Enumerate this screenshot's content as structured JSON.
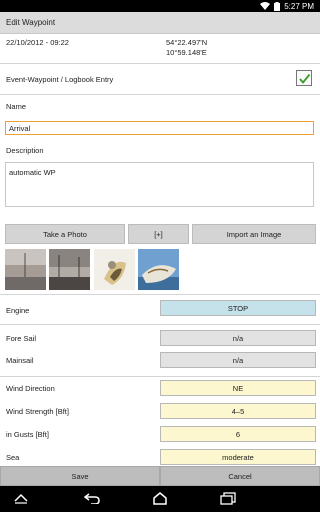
{
  "status_bar": {
    "time": "5:27 PM"
  },
  "header": {
    "title": "Edit Waypoint"
  },
  "waypoint": {
    "datetime": "22/10/2012 - 09:22",
    "latitude": "54°22.497'N",
    "longitude": "10°59.148'E",
    "event_label": "Event-Waypoint / Logbook Entry",
    "event_checked": true
  },
  "form": {
    "name_label": "Name",
    "name_value": "Arrival",
    "description_label": "Description",
    "description_value": "automatic WP"
  },
  "photo_buttons": {
    "take_photo": "Take a Photo",
    "add": "[+]",
    "import": "Import an Image"
  },
  "fields": {
    "engine": {
      "label": "Engine",
      "value": "STOP"
    },
    "fore_sail": {
      "label": "Fore Sail",
      "value": "n/a"
    },
    "mainsail": {
      "label": "Mainsail",
      "value": "n/a"
    },
    "wind_direction": {
      "label": "Wind Direction",
      "value": "NE"
    },
    "wind_strength": {
      "label": "Wind Strength [Bft]",
      "value": "4–5"
    },
    "gusts": {
      "label": "in Gusts [Bft]",
      "value": "6"
    },
    "sea": {
      "label": "Sea",
      "value": "moderate"
    }
  },
  "actions": {
    "save": "Save",
    "cancel": "Cancel"
  },
  "colors": {
    "accent_input_border": "#f0a030",
    "check_green": "#3a9a2a",
    "engine_box": "#c5e1ea",
    "sail_box": "#e2e2e2",
    "weather_box": "#fdf7cf"
  },
  "icons": [
    "wifi-icon",
    "battery-icon",
    "checkmark-icon",
    "back-icon",
    "home-icon",
    "recent-apps-icon",
    "collapse-icon"
  ]
}
